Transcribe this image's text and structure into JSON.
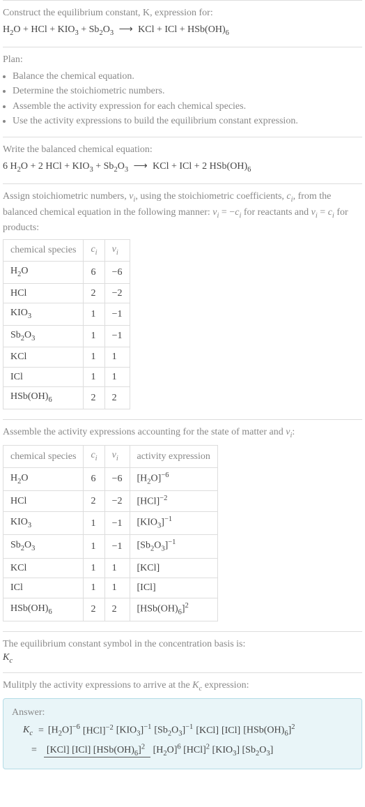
{
  "headings": {
    "construct": "Construct the equilibrium constant, K, expression for:",
    "plan": "Plan:",
    "writeBalanced": "Write the balanced chemical equation:",
    "assignStoich": "Assign stoichiometric numbers, νᵢ, using the stoichiometric coefficients, cᵢ, from the balanced chemical equation in the following manner: νᵢ = −cᵢ for reactants and νᵢ = cᵢ for products:",
    "assembleActivity": "Assemble the activity expressions accounting for the state of matter and νᵢ:",
    "eqConstSymbol": "The equilibrium constant symbol in the concentration basis is:",
    "kcSymbol": "K_c",
    "multiply": "Mulitply the activity expressions to arrive at the K_c expression:",
    "answer": "Answer:"
  },
  "unbalanced": {
    "lhs": [
      "H₂O",
      "HCl",
      "KIO₃",
      "Sb₂O₃"
    ],
    "rhs": [
      "KCl",
      "ICl",
      "HSb(OH)₆"
    ]
  },
  "balanced": {
    "lhs": [
      "6 H₂O",
      "2 HCl",
      "KIO₃",
      "Sb₂O₃"
    ],
    "rhs": [
      "KCl",
      "ICl",
      "2 HSb(OH)₆"
    ]
  },
  "plan": [
    "Balance the chemical equation.",
    "Determine the stoichiometric numbers.",
    "Assemble the activity expression for each chemical species.",
    "Use the activity expressions to build the equilibrium constant expression."
  ],
  "table1": {
    "headers": [
      "chemical species",
      "cᵢ",
      "νᵢ"
    ],
    "rows": [
      {
        "species": "H₂O",
        "c": "6",
        "v": "−6"
      },
      {
        "species": "HCl",
        "c": "2",
        "v": "−2"
      },
      {
        "species": "KIO₃",
        "c": "1",
        "v": "−1"
      },
      {
        "species": "Sb₂O₃",
        "c": "1",
        "v": "−1"
      },
      {
        "species": "KCl",
        "c": "1",
        "v": "1"
      },
      {
        "species": "ICl",
        "c": "1",
        "v": "1"
      },
      {
        "species": "HSb(OH)₆",
        "c": "2",
        "v": "2"
      }
    ]
  },
  "table2": {
    "headers": [
      "chemical species",
      "cᵢ",
      "νᵢ",
      "activity expression"
    ],
    "rows": [
      {
        "species": "H₂O",
        "c": "6",
        "v": "−6",
        "act": "[H₂O]⁻⁶"
      },
      {
        "species": "HCl",
        "c": "2",
        "v": "−2",
        "act": "[HCl]⁻²"
      },
      {
        "species": "KIO₃",
        "c": "1",
        "v": "−1",
        "act": "[KIO₃]⁻¹"
      },
      {
        "species": "Sb₂O₃",
        "c": "1",
        "v": "−1",
        "act": "[Sb₂O₃]⁻¹"
      },
      {
        "species": "KCl",
        "c": "1",
        "v": "1",
        "act": "[KCl]"
      },
      {
        "species": "ICl",
        "c": "1",
        "v": "1",
        "act": "[ICl]"
      },
      {
        "species": "HSb(OH)₆",
        "c": "2",
        "v": "2",
        "act": "[HSb(OH)₆]²"
      }
    ]
  },
  "answerLine1": {
    "prefix": "K_c =",
    "terms": [
      "[H₂O]⁻⁶",
      "[HCl]⁻²",
      "[KIO₃]⁻¹",
      "[Sb₂O₃]⁻¹",
      "[KCl]",
      "[ICl]",
      "[HSb(OH)₆]²"
    ]
  },
  "answerLine2": {
    "prefix": "=",
    "num": [
      "[KCl]",
      "[ICl]",
      "[HSb(OH)₆]²"
    ],
    "den": [
      "[H₂O]⁶",
      "[HCl]²",
      "[KIO₃]",
      "[Sb₂O₃]"
    ]
  }
}
